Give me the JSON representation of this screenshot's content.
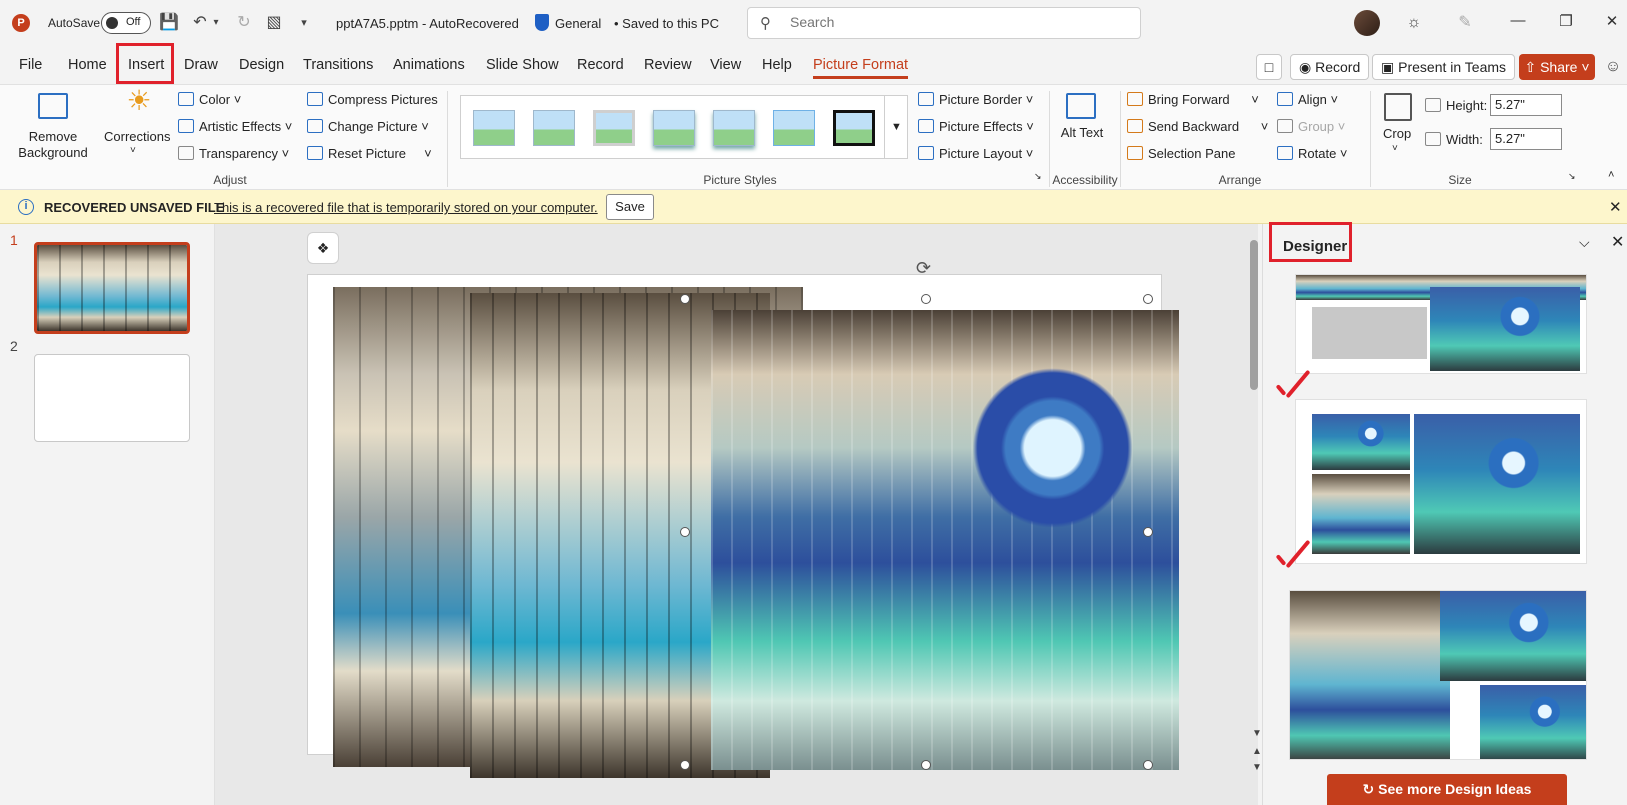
{
  "titlebar": {
    "app_logo": "P",
    "autosave_label": "AutoSave",
    "autosave_state": "Off",
    "doc_title": "pptA7A5.pptm - AutoRecovered",
    "sensitivity": "General",
    "saved_state": "• Saved to this PC",
    "search_placeholder": "Search",
    "icons": [
      "save-icon",
      "undo-icon",
      "redo-icon",
      "present-icon",
      "customize-icon",
      "lightbulb-icon",
      "pen-icon"
    ]
  },
  "tabs": [
    "File",
    "Home",
    "Insert",
    "Draw",
    "Design",
    "Transitions",
    "Animations",
    "Slide Show",
    "Record",
    "Review",
    "View",
    "Help",
    "Picture Format"
  ],
  "active_tab": "Picture Format",
  "header_buttons": {
    "record": "Record",
    "present_teams": "Present in Teams",
    "share": "Share"
  },
  "ribbon": {
    "adjust": {
      "remove_background": "Remove Background",
      "corrections": "Corrections",
      "color": "Color",
      "artistic_effects": "Artistic Effects",
      "transparency": "Transparency",
      "compress": "Compress Pictures",
      "change": "Change Picture",
      "reset": "Reset Picture",
      "label": "Adjust"
    },
    "styles": {
      "label": "Picture Styles"
    },
    "picture_border": "Picture Border",
    "picture_effects": "Picture Effects",
    "picture_layout": "Picture Layout",
    "accessibility": {
      "alt_text": "Alt Text",
      "label": "Accessibility"
    },
    "arrange": {
      "bring_forward": "Bring Forward",
      "send_backward": "Send Backward",
      "selection_pane": "Selection Pane",
      "align": "Align",
      "group": "Group",
      "rotate": "Rotate",
      "label": "Arrange"
    },
    "size": {
      "crop": "Crop",
      "height_label": "Height:",
      "height_value": "5.27\"",
      "width_label": "Width:",
      "width_value": "5.27\"",
      "label": "Size"
    }
  },
  "infobar": {
    "title": "RECOVERED UNSAVED FILE",
    "message": "This is a recovered file that is temporarily stored on your computer.",
    "save": "Save"
  },
  "slides": [
    {
      "number": "1",
      "active": true
    },
    {
      "number": "2",
      "active": false
    }
  ],
  "designer": {
    "title": "Designer",
    "more": "See more Design Ideas"
  },
  "colors": {
    "accent": "#c43e1c",
    "highlight_box": "#e0212b",
    "infobar_bg": "#fdf6cc"
  }
}
